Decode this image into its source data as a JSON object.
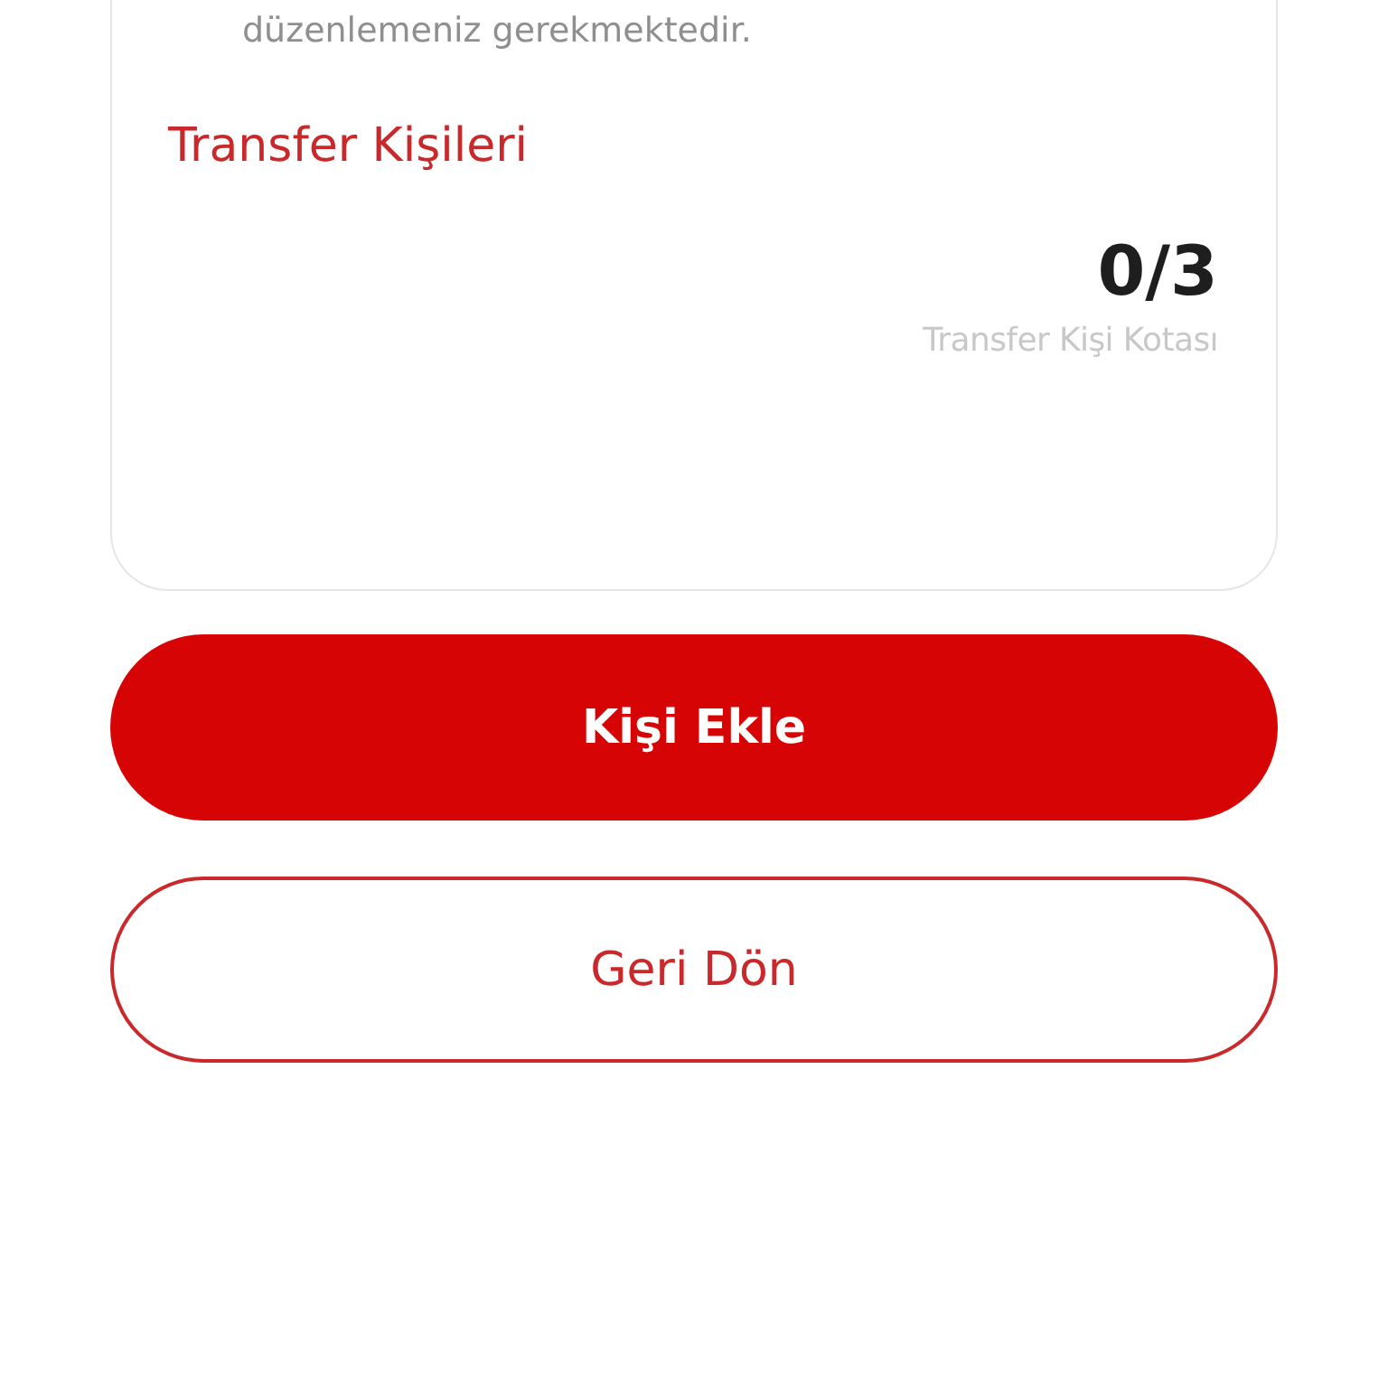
{
  "notice": {
    "text": "düzenlemeniz gerekmektedir."
  },
  "section_title": "Transfer Kişileri",
  "quota": {
    "value": "0/3",
    "label": "Transfer Kişi Kotası"
  },
  "buttons": [
    {
      "label": "Kişi Ekle",
      "kind": "primary"
    },
    {
      "label": "Geri Dön",
      "kind": "secondary"
    }
  ]
}
